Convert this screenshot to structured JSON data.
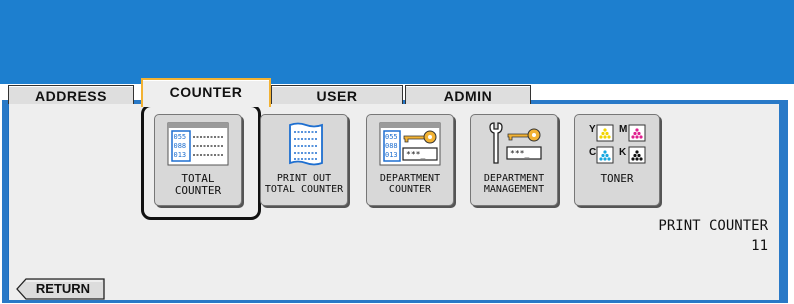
{
  "tabs": [
    {
      "label": "ADDRESS",
      "active": false
    },
    {
      "label": "COUNTER",
      "active": true
    },
    {
      "label": "USER",
      "active": false
    },
    {
      "label": "ADMIN",
      "active": false
    }
  ],
  "buttons": [
    {
      "line1": "TOTAL",
      "line2": "COUNTER",
      "icon": "counter-sheet-icon",
      "selected": true
    },
    {
      "line1": "PRINT OUT",
      "line2": "TOTAL COUNTER",
      "icon": "printed-sheet-icon",
      "selected": false
    },
    {
      "line1": "DEPARTMENT",
      "line2": "COUNTER",
      "icon": "counter-key-icon",
      "selected": false
    },
    {
      "line1": "DEPARTMENT",
      "line2": "MANAGEMENT",
      "icon": "wrench-key-icon",
      "selected": false
    },
    {
      "line1": "TONER",
      "line2": "",
      "icon": "toner-icon",
      "selected": false
    }
  ],
  "icon_text": {
    "codes": [
      "055",
      "088",
      "013"
    ],
    "password_mask": "***_",
    "toner_letters": [
      "Y",
      "M",
      "C",
      "K"
    ]
  },
  "print_counter": {
    "title": "PRINT COUNTER",
    "value": "11"
  },
  "return_label": "RETURN",
  "colors": {
    "header": "#1d7fcf",
    "frame": "#2979c7",
    "panel": "#eeeeee",
    "active_tab_border": "#f2b233",
    "toner_yellow": "#f2d400",
    "toner_magenta": "#e0208f",
    "toner_cyan": "#17a8e0",
    "toner_black": "#111111"
  }
}
